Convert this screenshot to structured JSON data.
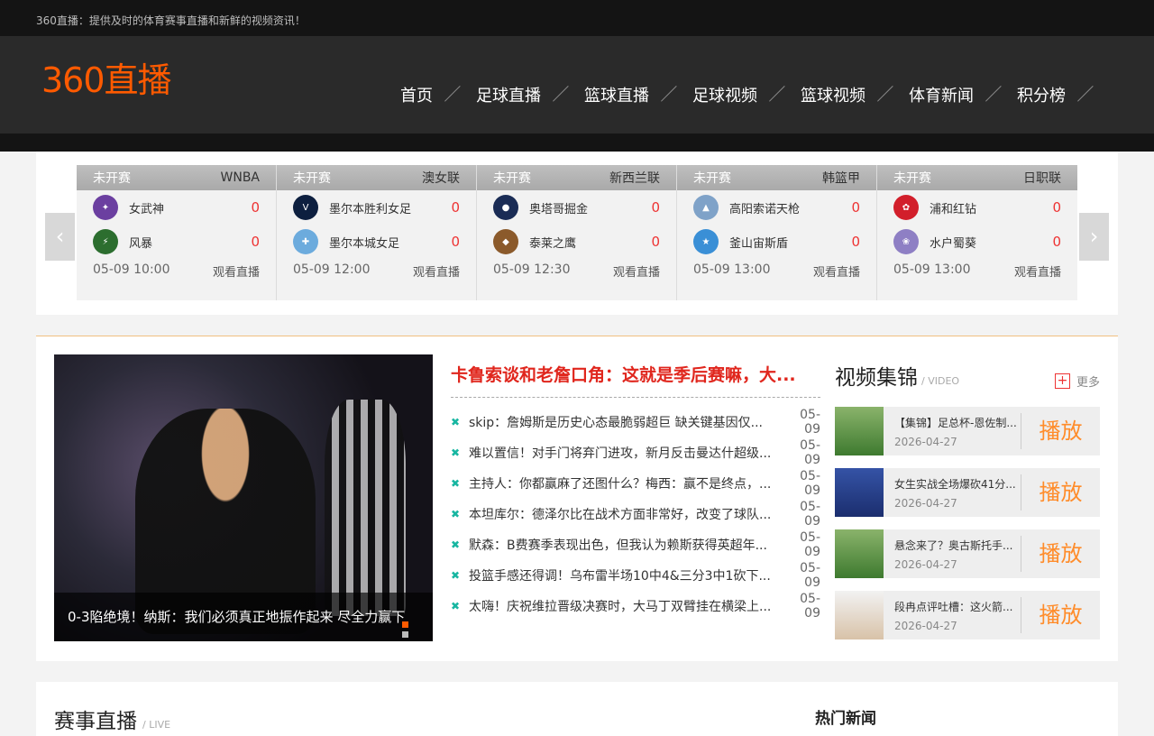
{
  "site": {
    "tagline": "360直播：提供及时的体育赛事直播和新鲜的视频资讯！",
    "logo": "360直播",
    "brand_color": "#ff5a00"
  },
  "nav": [
    {
      "label": "首页"
    },
    {
      "label": "足球直播"
    },
    {
      "label": "篮球直播"
    },
    {
      "label": "足球视频"
    },
    {
      "label": "篮球视频"
    },
    {
      "label": "体育新闻"
    },
    {
      "label": "积分榜"
    }
  ],
  "matches": [
    {
      "status": "未开赛",
      "league": "WNBA",
      "home": {
        "name": "女武神",
        "score": "0",
        "icon": "valkyries-badge-icon",
        "color": "#6b3fa0"
      },
      "away": {
        "name": "风暴",
        "score": "0",
        "icon": "storm-badge-icon",
        "color": "#2c6e2f"
      },
      "time": "05-09 10:00",
      "watch": "观看直播"
    },
    {
      "status": "未开赛",
      "league": "澳女联",
      "home": {
        "name": "墨尔本胜利女足",
        "score": "0",
        "icon": "melbourne-victory-badge-icon",
        "color": "#0d1f3f"
      },
      "away": {
        "name": "墨尔本城女足",
        "score": "0",
        "icon": "melbourne-city-badge-icon",
        "color": "#6cabdd"
      },
      "time": "05-09 12:00",
      "watch": "观看直播"
    },
    {
      "status": "未开赛",
      "league": "新西兰联",
      "home": {
        "name": "奥塔哥掘金",
        "score": "0",
        "icon": "otago-nuggets-badge-icon",
        "color": "#1a2c55"
      },
      "away": {
        "name": "泰莱之鹰",
        "score": "0",
        "icon": "hawks-badge-icon",
        "color": "#8b5a2b"
      },
      "time": "05-09 12:30",
      "watch": "观看直播"
    },
    {
      "status": "未开赛",
      "league": "韩篮甲",
      "home": {
        "name": "高阳索诺天枪",
        "score": "0",
        "icon": "goyang-badge-icon",
        "color": "#7fa2c8"
      },
      "away": {
        "name": "釜山宙斯盾",
        "score": "0",
        "icon": "busan-badge-icon",
        "color": "#3a8fd6"
      },
      "time": "05-09 13:00",
      "watch": "观看直播"
    },
    {
      "status": "未开赛",
      "league": "日职联",
      "home": {
        "name": "浦和红钻",
        "score": "0",
        "icon": "urawa-badge-icon",
        "color": "#d21f2b"
      },
      "away": {
        "name": "水户蜀葵",
        "score": "0",
        "icon": "mito-badge-icon",
        "color": "#8e7fc4"
      },
      "time": "05-09 13:00",
      "watch": "观看直播"
    }
  ],
  "hero": {
    "caption": "0-3陷绝境！纳斯：我们必须真正地振作起来 尽全力赢下"
  },
  "news": {
    "headline": "卡鲁索谈和老詹口角：这就是季后赛嘛，大...",
    "items": [
      {
        "title": "skip：詹姆斯是历史心态最脆弱超巨 缺关键基因仅...",
        "date": "05-09"
      },
      {
        "title": "难以置信！对手门将弃门进攻，新月反击曼达什超级...",
        "date": "05-09"
      },
      {
        "title": "主持人：你都赢麻了还图什么？梅西：赢不是终点，...",
        "date": "05-09"
      },
      {
        "title": "本坦库尔：德泽尔比在战术方面非常好，改变了球队...",
        "date": "05-09"
      },
      {
        "title": "默森：B费赛季表现出色，但我认为赖斯获得英超年...",
        "date": "05-09"
      },
      {
        "title": "投篮手感还得调！乌布雷半场10中4&三分3中1砍下...",
        "date": "05-09"
      },
      {
        "title": "太嗨！庆祝维拉晋级决赛时，大马丁双臂挂在横梁上...",
        "date": "05-09"
      }
    ]
  },
  "videos": {
    "title": "视频集锦",
    "subtitle": "/ VIDEO",
    "more": "更多",
    "play_label": "播放",
    "items": [
      {
        "title": "【集锦】足总杯-恩佐制...",
        "date": "2026-04-27"
      },
      {
        "title": "女生实战全场爆砍41分...",
        "date": "2026-04-27"
      },
      {
        "title": "悬念来了？奥古斯托手...",
        "date": "2026-04-27"
      },
      {
        "title": "段冉点评吐槽：这火箭...",
        "date": "2026-04-27"
      }
    ]
  },
  "bottom": {
    "live_title": "赛事直播",
    "live_sub": "/ LIVE",
    "hot_title": "热门新闻"
  }
}
